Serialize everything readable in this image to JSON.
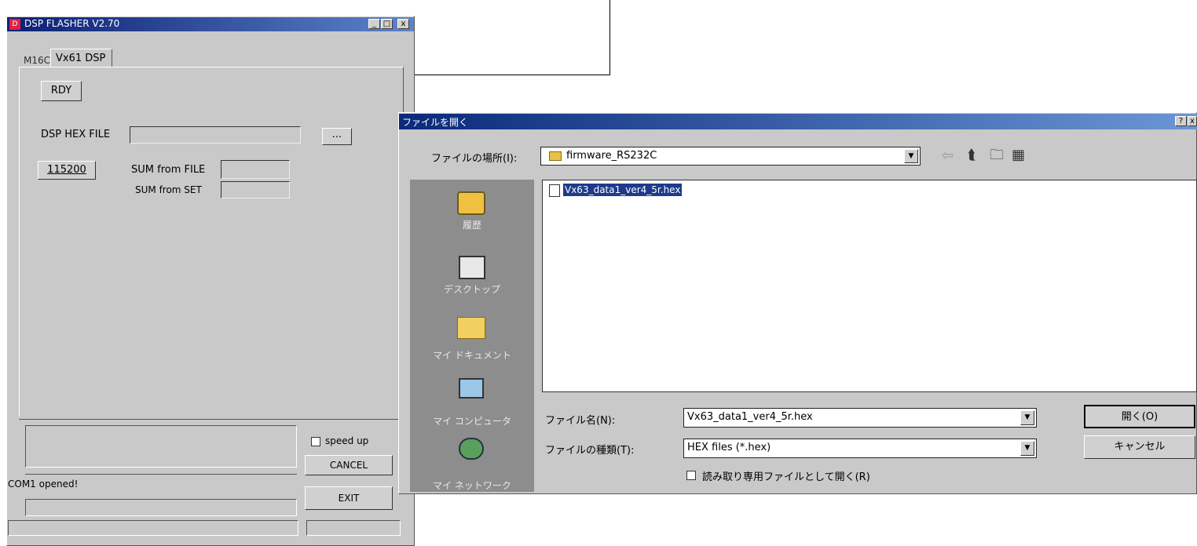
{
  "main_window": {
    "title": "DSP FLASHER V2.70",
    "controls": {
      "minimize": "_",
      "maximize": "□",
      "close": "x"
    },
    "tabs": [
      {
        "label": "M16C"
      },
      {
        "label": "Vx61 DSP"
      }
    ],
    "rdy_button": "RDY",
    "dsp_hex_file_label": "DSP HEX FILE",
    "dsp_hex_file_value": "",
    "browse_button": "...",
    "baud_button": "115200",
    "sum_from_file_label": "SUM from FILE",
    "sum_from_set_label": "SUM from SET",
    "sum_from_file_value": "",
    "sum_from_set_value": "",
    "speed_up_label": "speed up",
    "cancel_button": "CANCEL",
    "exit_button": "EXIT",
    "status_text": "COM1 opened!"
  },
  "dialog": {
    "title": "ファイルを開く",
    "help_button": "?",
    "close_button": "x",
    "look_in_label": "ファイルの場所(I):",
    "look_in_value": "firmware_RS232C",
    "files": [
      {
        "name": "Vx63_data1_ver4_5r.hex",
        "selected": true
      }
    ],
    "places": [
      {
        "label": "履歴",
        "icon": "history-icon"
      },
      {
        "label": "デスクトップ",
        "icon": "desktop-icon"
      },
      {
        "label": "マイ ドキュメント",
        "icon": "my-documents-icon"
      },
      {
        "label": "マイ コンピュータ",
        "icon": "my-computer-icon"
      },
      {
        "label": "マイ ネットワーク",
        "icon": "my-network-icon"
      }
    ],
    "filename_label": "ファイル名(N):",
    "filename_value": "Vx63_data1_ver4_5r.hex",
    "filetype_label": "ファイルの種類(T):",
    "filetype_value": "HEX files (*.hex)",
    "readonly_label": "読み取り専用ファイルとして開く(R)",
    "open_button": "開く(O)",
    "cancel_button": "キャンセル"
  },
  "colors": {
    "window_bg": "#c9c9c9",
    "titlebar": "#0b1f74",
    "selection": "#1e3a8a",
    "places_bg": "#8d8d8d"
  }
}
